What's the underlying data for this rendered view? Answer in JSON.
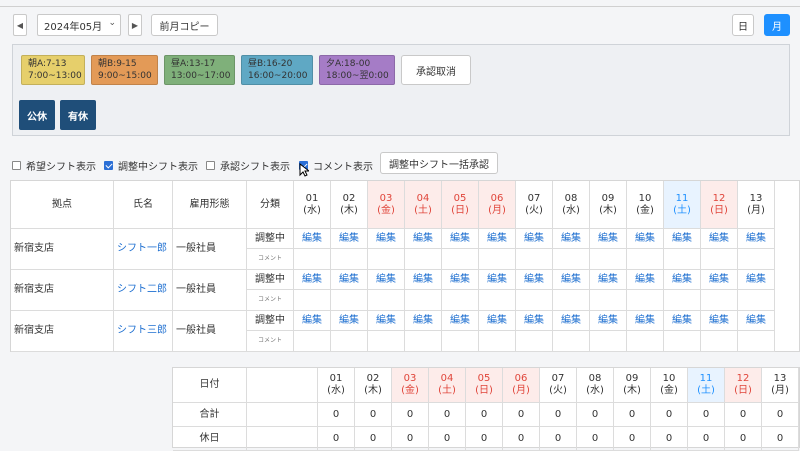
{
  "toolbar": {
    "prev": "◀",
    "next": "▶",
    "month": "2024年05月",
    "copy_prev": "前月コピー",
    "view_day": "日",
    "view_month": "月"
  },
  "shifts": [
    {
      "line1": "朝A:7-13",
      "line2": "7:00~13:00",
      "color": "#e6cf6b"
    },
    {
      "line1": "朝B:9-15",
      "line2": "9:00~15:00",
      "color": "#e39a57"
    },
    {
      "line1": "昼A:13-17",
      "line2": "13:00~17:00",
      "color": "#7fb07a"
    },
    {
      "line1": "昼B:16-20",
      "line2": "16:00~20:00",
      "color": "#5fa8c4"
    },
    {
      "line1": "夕A:18-00",
      "line2": "18:00~翌0:00",
      "color": "#a57cc6"
    }
  ],
  "approve_cancel": "承認取消",
  "leave_buttons": [
    "公休",
    "有休"
  ],
  "options": {
    "wish": "希望シフト表示",
    "adjusting": "調整中シフト表示",
    "approved": "承認シフト表示",
    "comment": "コメント表示",
    "bulk_approve": "調整中シフト一括承認"
  },
  "table": {
    "headers": {
      "base": "拠点",
      "name": "氏名",
      "employment": "雇用形態",
      "category": "分類"
    },
    "days": [
      {
        "d": "01",
        "w": "(水)",
        "type": "normal"
      },
      {
        "d": "02",
        "w": "(木)",
        "type": "normal"
      },
      {
        "d": "03",
        "w": "(金)",
        "type": "holiday"
      },
      {
        "d": "04",
        "w": "(土)",
        "type": "holiday"
      },
      {
        "d": "05",
        "w": "(日)",
        "type": "holiday"
      },
      {
        "d": "06",
        "w": "(月)",
        "type": "holiday"
      },
      {
        "d": "07",
        "w": "(火)",
        "type": "normal"
      },
      {
        "d": "08",
        "w": "(水)",
        "type": "normal"
      },
      {
        "d": "09",
        "w": "(木)",
        "type": "normal"
      },
      {
        "d": "10",
        "w": "(金)",
        "type": "normal"
      },
      {
        "d": "11",
        "w": "(土)",
        "type": "sat"
      },
      {
        "d": "12",
        "w": "(日)",
        "type": "holiday"
      },
      {
        "d": "13",
        "w": "(月)",
        "type": "normal"
      }
    ],
    "edit_label": "編集",
    "category_adjusting": "調整中",
    "category_comment": "コメント",
    "rows": [
      {
        "base": "新宿支店",
        "name": "シフト一郎",
        "employment": "一般社員"
      },
      {
        "base": "新宿支店",
        "name": "シフト二郎",
        "employment": "一般社員"
      },
      {
        "base": "新宿支店",
        "name": "シフト三郎",
        "employment": "一般社員"
      }
    ]
  },
  "summary": {
    "date_label": "日付",
    "days": [
      {
        "d": "01",
        "w": "(水)",
        "type": "normal"
      },
      {
        "d": "02",
        "w": "(木)",
        "type": "normal"
      },
      {
        "d": "03",
        "w": "(金)",
        "type": "holiday"
      },
      {
        "d": "04",
        "w": "(土)",
        "type": "holiday"
      },
      {
        "d": "05",
        "w": "(日)",
        "type": "holiday"
      },
      {
        "d": "06",
        "w": "(月)",
        "type": "holiday"
      },
      {
        "d": "07",
        "w": "(火)",
        "type": "normal"
      },
      {
        "d": "08",
        "w": "(水)",
        "type": "normal"
      },
      {
        "d": "09",
        "w": "(木)",
        "type": "normal"
      },
      {
        "d": "10",
        "w": "(金)",
        "type": "normal"
      },
      {
        "d": "11",
        "w": "(土)",
        "type": "sat"
      },
      {
        "d": "12",
        "w": "(日)",
        "type": "holiday"
      },
      {
        "d": "13",
        "w": "(月)",
        "type": "normal"
      }
    ],
    "rows": [
      {
        "label": "合計",
        "values": [
          "0",
          "0",
          "0",
          "0",
          "0",
          "0",
          "0",
          "0",
          "0",
          "0",
          "0",
          "0",
          "0"
        ]
      },
      {
        "label": "休日",
        "values": [
          "0",
          "0",
          "0",
          "0",
          "0",
          "0",
          "0",
          "0",
          "0",
          "0",
          "0",
          "0",
          "0"
        ]
      }
    ]
  }
}
